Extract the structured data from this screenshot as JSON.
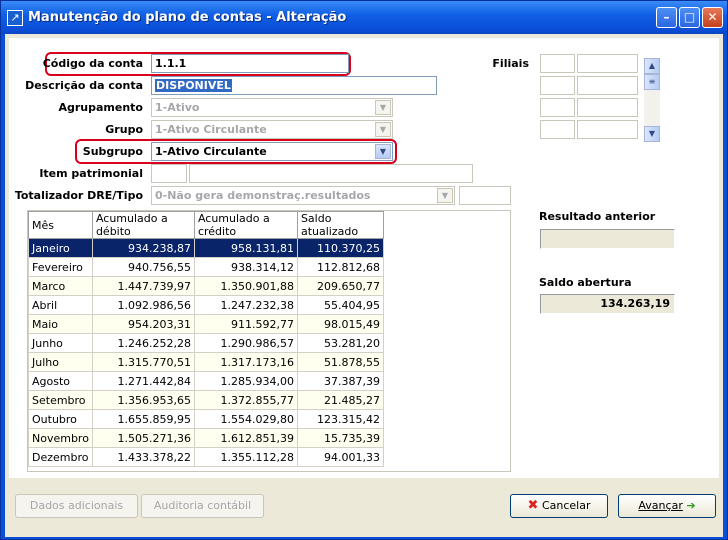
{
  "window": {
    "title": "Manutenção do plano de contas - Alteração",
    "minimize": "–",
    "maximize": "□",
    "close": "✕"
  },
  "form": {
    "codigo_label": "Código da conta",
    "codigo_value": "1.1.1",
    "descricao_label": "Descrição da conta",
    "descricao_value": "DISPONIVEL",
    "agrupamento_label": "Agrupamento",
    "agrupamento_value": "1-Ativo",
    "grupo_label": "Grupo",
    "grupo_value": "1-Ativo Circulante",
    "subgrupo_label": "Subgrupo",
    "subgrupo_value": "1-Ativo Circulante",
    "item_label": "Item patrimonial",
    "totalizador_label": "Totalizador DRE/Tipo",
    "totalizador_value": "0-Não gera demonstraç.resultados",
    "filiais_label": "Filiais"
  },
  "grid": {
    "headers": [
      "Mês",
      "Acumulado a débito",
      "Acumulado a crédito",
      "Saldo atualizado"
    ],
    "rows": [
      [
        "Janeiro",
        "934.238,87",
        "958.131,81",
        "110.370,25"
      ],
      [
        "Fevereiro",
        "940.756,55",
        "938.314,12",
        "112.812,68"
      ],
      [
        "Marco",
        "1.447.739,97",
        "1.350.901,88",
        "209.650,77"
      ],
      [
        "Abril",
        "1.092.986,56",
        "1.247.232,38",
        "55.404,95"
      ],
      [
        "Maio",
        "954.203,31",
        "911.592,77",
        "98.015,49"
      ],
      [
        "Junho",
        "1.246.252,28",
        "1.290.986,57",
        "53.281,20"
      ],
      [
        "Julho",
        "1.315.770,51",
        "1.317.173,16",
        "51.878,55"
      ],
      [
        "Agosto",
        "1.271.442,84",
        "1.285.934,00",
        "37.387,39"
      ],
      [
        "Setembro",
        "1.356.953,65",
        "1.372.855,77",
        "21.485,27"
      ],
      [
        "Outubro",
        "1.655.859,95",
        "1.554.029,80",
        "123.315,42"
      ],
      [
        "Novembro",
        "1.505.271,36",
        "1.612.851,39",
        "15.735,39"
      ],
      [
        "Dezembro",
        "1.433.378,22",
        "1.355.112,28",
        "94.001,33"
      ]
    ]
  },
  "side": {
    "resultado_label": "Resultado anterior",
    "resultado_value": "",
    "saldo_label": "Saldo abertura",
    "saldo_value": "134.263,19"
  },
  "buttons": {
    "dados": "Dados adicionais",
    "auditoria": "Auditoria contábil",
    "cancelar": "Cancelar",
    "avancar": "Avançar"
  },
  "colors": {
    "title_blue": "#0a4ed8",
    "highlight_red": "#d8001c",
    "selected_row": "#0a246a"
  }
}
